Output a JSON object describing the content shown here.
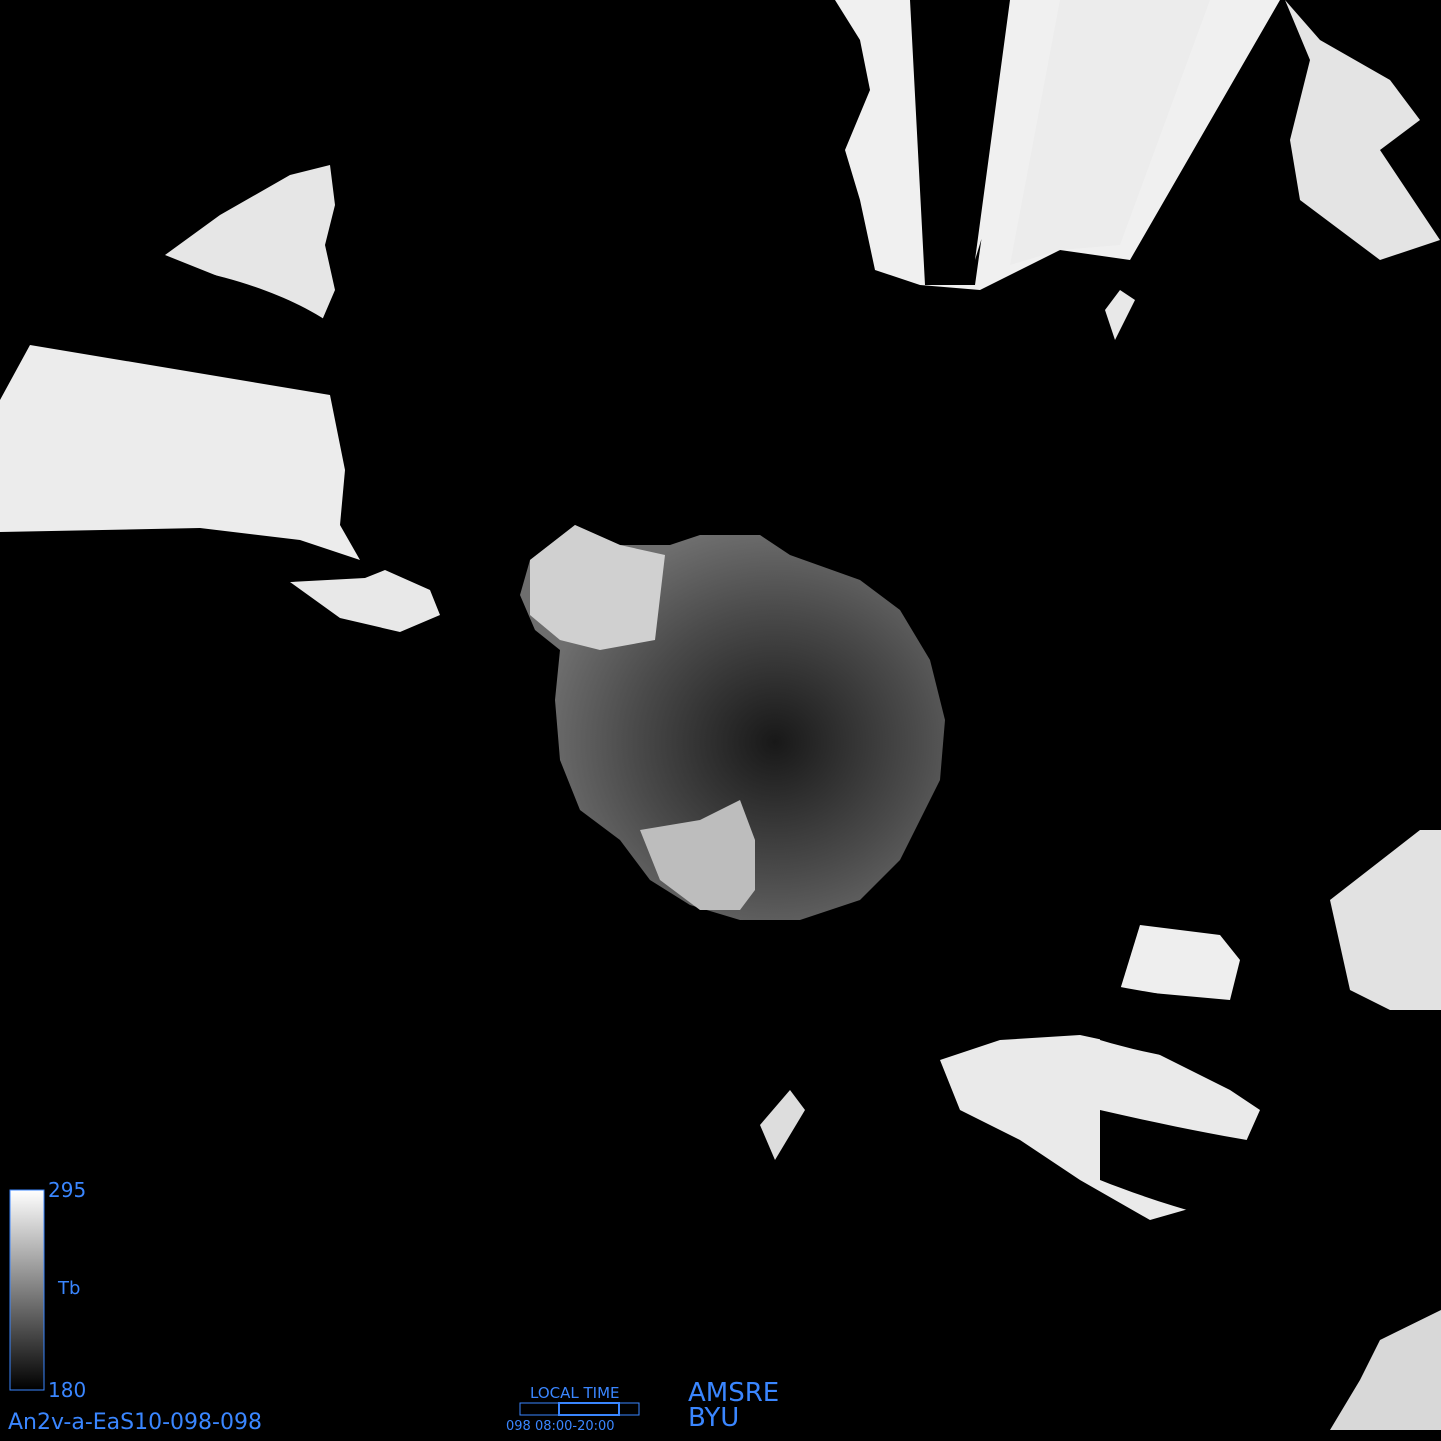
{
  "map": {
    "background_color": "#000000",
    "land_color": "#f2f2f2",
    "text_color": "#3a86ff"
  },
  "colorbar": {
    "max_label": "295",
    "min_label": "180",
    "unit_label": "Tb",
    "min_value": 180,
    "max_value": 295,
    "color_low": "#000000",
    "color_high": "#ffffff"
  },
  "product_id": "An2v-a-EaS10-098-098",
  "local_time": {
    "title": "LOCAL TIME",
    "range": "098  08:00-20:00"
  },
  "sensor": {
    "instrument": "AMSRE",
    "institution": "BYU"
  }
}
